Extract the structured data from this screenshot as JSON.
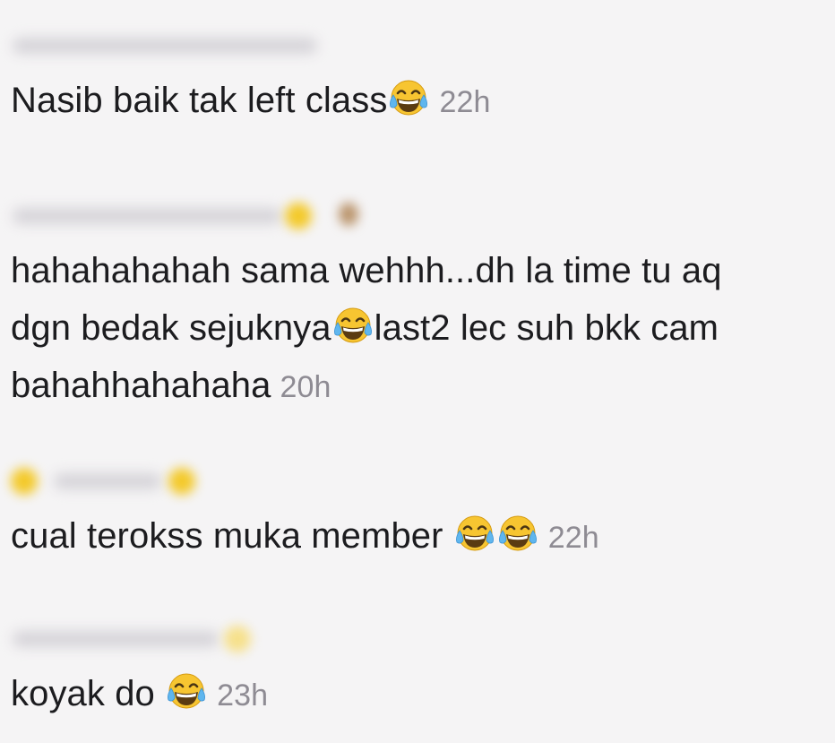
{
  "comments": [
    {
      "username": "",
      "text_before": "Nasib baik tak left class",
      "emoji": "face-with-tears-of-joy",
      "time": "22h"
    },
    {
      "username": "",
      "line1": "hahahahahah sama wehhh...dh la time tu aq",
      "line2_before": "dgn bedak sejuknya",
      "emoji": "face-with-tears-of-joy",
      "line2_after": "last2 lec suh bkk cam",
      "line3": "bahahhahahaha",
      "time": "20h"
    },
    {
      "username": "",
      "text_before": "cual terokss muka member ",
      "emoji": "face-with-tears-of-joy",
      "time": "22h"
    },
    {
      "username": "",
      "text_before": "koyak do ",
      "emoji": "face-with-tears-of-joy",
      "time": "23h"
    }
  ],
  "colors": {
    "background": "#f5f4f5",
    "text": "#1c1c1f",
    "timestamp": "#8e8b93"
  }
}
